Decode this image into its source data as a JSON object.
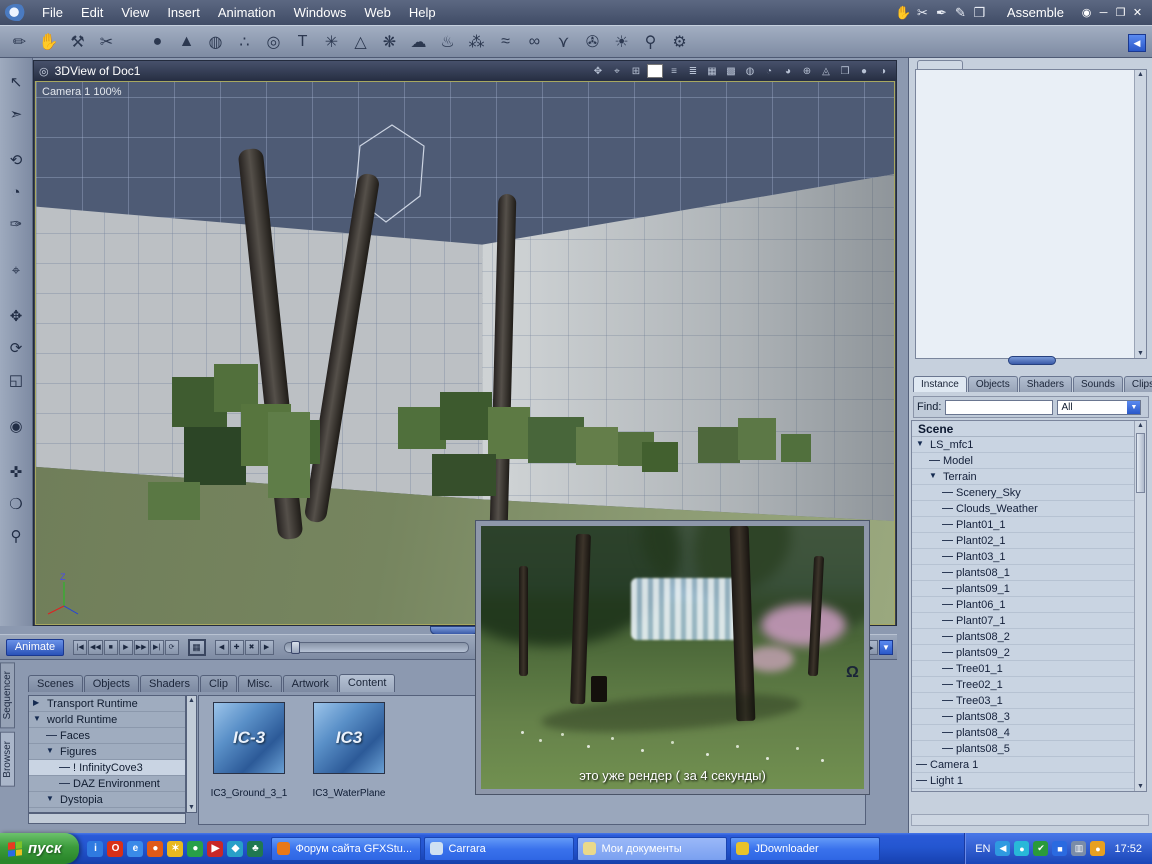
{
  "app": {
    "mode_label": "Assemble"
  },
  "menu": {
    "items": [
      "File",
      "Edit",
      "View",
      "Insert",
      "Animation",
      "Windows",
      "Web",
      "Help"
    ],
    "right_tools": [
      {
        "name": "hand-tool-icon",
        "glyph": "✋"
      },
      {
        "name": "knife-tool-icon",
        "glyph": "✂"
      },
      {
        "name": "pen-tool-icon",
        "glyph": "✒"
      },
      {
        "name": "pencil-tool-icon",
        "glyph": "✎"
      },
      {
        "name": "box-tool-icon",
        "glyph": "❒"
      }
    ],
    "window_buttons": [
      {
        "name": "eye-icon",
        "glyph": "◉"
      },
      {
        "name": "minimize-button",
        "glyph": "─"
      },
      {
        "name": "maximize-button",
        "glyph": "❐"
      },
      {
        "name": "close-button",
        "glyph": "✕"
      }
    ]
  },
  "toolbar": {
    "left_tools": [
      {
        "name": "brush-tool-icon",
        "glyph": "✏"
      },
      {
        "name": "hand-tool-icon",
        "glyph": "✋"
      },
      {
        "name": "wrench-tool-icon",
        "glyph": "⚒"
      },
      {
        "name": "cut-tool-icon",
        "glyph": "✂"
      }
    ],
    "insert_icons": [
      {
        "name": "insert-sphere-icon",
        "glyph": "●"
      },
      {
        "name": "insert-cone-icon",
        "glyph": "▲"
      },
      {
        "name": "insert-geosphere-icon",
        "glyph": "◍"
      },
      {
        "name": "insert-molecule-icon",
        "glyph": "∴"
      },
      {
        "name": "insert-torus-icon",
        "glyph": "◎"
      },
      {
        "name": "insert-text-icon",
        "glyph": "T"
      },
      {
        "name": "insert-particles-icon",
        "glyph": "✳"
      },
      {
        "name": "insert-terrain-icon",
        "glyph": "△"
      },
      {
        "name": "insert-plant-icon",
        "glyph": "❋"
      },
      {
        "name": "insert-cloud-icon",
        "glyph": "☁"
      },
      {
        "name": "insert-fire-icon",
        "glyph": "♨"
      },
      {
        "name": "insert-fountain-icon",
        "glyph": "⁂"
      },
      {
        "name": "insert-ocean-icon",
        "glyph": "≈"
      },
      {
        "name": "insert-metaball-icon",
        "glyph": "∞"
      },
      {
        "name": "insert-bone-icon",
        "glyph": "⋎"
      },
      {
        "name": "insert-camera-icon",
        "glyph": "✇"
      },
      {
        "name": "insert-light-icon",
        "glyph": "☀"
      },
      {
        "name": "insert-walk-icon",
        "glyph": "⚲"
      },
      {
        "name": "insert-gear-icon",
        "glyph": "⚙"
      }
    ]
  },
  "left_tools": [
    {
      "name": "select-tool-icon",
      "glyph": "↖"
    },
    {
      "name": "lasso-tool-icon",
      "glyph": "➣"
    },
    {
      "name": "rotate-view-tool-icon",
      "glyph": "⟲",
      "gap": true
    },
    {
      "name": "sphere-view-tool-icon",
      "glyph": "◔"
    },
    {
      "name": "eyedropper-tool-icon",
      "glyph": "✑"
    },
    {
      "name": "magnet-tool-icon",
      "glyph": "⌖",
      "gap": true
    },
    {
      "name": "move-tool-icon",
      "glyph": "✥",
      "gap": true
    },
    {
      "name": "rotate-tool-icon",
      "glyph": "⟳"
    },
    {
      "name": "scale-tool-icon",
      "glyph": "◱"
    },
    {
      "name": "paint-tool-icon",
      "glyph": "◉",
      "gap": true
    },
    {
      "name": "camera-pan-tool-icon",
      "glyph": "✜",
      "gap": true
    },
    {
      "name": "dolly-tool-icon",
      "glyph": "❍"
    },
    {
      "name": "zoom-tool-icon",
      "glyph": "⚲"
    }
  ],
  "viewport": {
    "title": "3DView of Doc1",
    "icon_glyph": "◎",
    "camera_label": "Camera 1 100%",
    "header_icons": [
      {
        "name": "position-icon",
        "glyph": "✥"
      },
      {
        "name": "aim-icon",
        "glyph": "⌖"
      },
      {
        "name": "grid-icon",
        "glyph": "⊞"
      },
      {
        "name": "white-mode-icon",
        "glyph": "■",
        "active": true
      },
      {
        "name": "wire-mode-icon",
        "glyph": "≡"
      },
      {
        "name": "lines-mode-icon",
        "glyph": "≣"
      },
      {
        "name": "box-mode-icon",
        "glyph": "▦"
      },
      {
        "name": "textured-mode-icon",
        "glyph": "▩"
      },
      {
        "name": "globe-wire-icon",
        "glyph": "◍"
      },
      {
        "name": "globe-flat-icon",
        "glyph": "◔"
      },
      {
        "name": "globe-shaded-icon",
        "glyph": "◕"
      },
      {
        "name": "axis-cross-icon",
        "glyph": "⊕"
      },
      {
        "name": "triangle-icon",
        "glyph": "◬"
      },
      {
        "name": "cube-icon",
        "glyph": "❒"
      },
      {
        "name": "sphere-light-icon",
        "glyph": "●"
      },
      {
        "name": "sphere-dark-icon",
        "glyph": "◑"
      }
    ]
  },
  "transport": {
    "animate_label": "Animate",
    "film_glyph": "▦",
    "buttons": [
      {
        "name": "go-start-button",
        "glyph": "|◀"
      },
      {
        "name": "prev-frame-button",
        "glyph": "◀◀"
      },
      {
        "name": "stop-button",
        "glyph": "■"
      },
      {
        "name": "play-button",
        "glyph": "▶"
      },
      {
        "name": "next-frame-button",
        "glyph": "▶▶"
      },
      {
        "name": "go-end-button",
        "glyph": "▶|"
      },
      {
        "name": "loop-button",
        "glyph": "⟳"
      }
    ],
    "key_buttons": [
      {
        "name": "prev-key-button",
        "glyph": "◀"
      },
      {
        "name": "add-key-button",
        "glyph": "✚"
      },
      {
        "name": "delete-key-button",
        "glyph": "✖"
      },
      {
        "name": "next-key-button",
        "glyph": "▶"
      }
    ],
    "right_buttons": [
      {
        "name": "scroll-left-button",
        "glyph": "◀"
      },
      {
        "name": "scroll-right-button",
        "glyph": "▶"
      },
      {
        "name": "scroll-down-button",
        "glyph": "▼",
        "blue": true
      }
    ]
  },
  "render": {
    "caption": "это уже рендер ( за 4 секунды)"
  },
  "side_tab_items": [
    {
      "label": "Sequencer",
      "name": "tab-sequencer"
    },
    {
      "label": "Browser",
      "name": "tab-browser",
      "active": true
    }
  ],
  "browser": {
    "tabs": [
      {
        "label": "Scenes"
      },
      {
        "label": "Objects"
      },
      {
        "label": "Shaders"
      },
      {
        "label": "Clip"
      },
      {
        "label": "Misc."
      },
      {
        "label": "Artwork"
      },
      {
        "label": "Content",
        "active": true
      }
    ],
    "tree": [
      {
        "label": "Transport Runtime",
        "level": 0,
        "arrow": "right"
      },
      {
        "label": "world Runtime",
        "level": 0,
        "arrow": "down"
      },
      {
        "label": "Faces",
        "level": 1
      },
      {
        "label": "Figures",
        "level": 1,
        "arrow": "down"
      },
      {
        "label": "! InfinityCove3",
        "level": 2,
        "selected": true
      },
      {
        "label": "DAZ Environment",
        "level": 2
      },
      {
        "label": "Dystopia",
        "level": 1,
        "arrow": "down"
      }
    ],
    "items": [
      {
        "label": "IC3_Ground_3_1",
        "art": "IC-3"
      },
      {
        "label": "IC3_WaterPlane",
        "art": "IC3"
      }
    ],
    "audio_glyph": "Ω"
  },
  "right_panel": {
    "collapse_glyph": "◀",
    "tabs": [
      {
        "label": "Instance",
        "active": true
      },
      {
        "label": "Objects"
      },
      {
        "label": "Shaders"
      },
      {
        "label": "Sounds"
      },
      {
        "label": "Clips"
      }
    ],
    "find_label": "Find:",
    "find_value": "",
    "filter_value": "All",
    "scene_label": "Scene",
    "tree": [
      {
        "label": "LS_mfc1",
        "level": 0,
        "arrow": "down"
      },
      {
        "label": "Model",
        "level": 1
      },
      {
        "label": "Terrain",
        "level": 1,
        "arrow": "down"
      },
      {
        "label": "Scenery_Sky",
        "level": 2
      },
      {
        "label": "Clouds_Weather",
        "level": 2
      },
      {
        "label": "Plant01_1",
        "level": 2
      },
      {
        "label": "Plant02_1",
        "level": 2
      },
      {
        "label": "Plant03_1",
        "level": 2
      },
      {
        "label": "plants08_1",
        "level": 2
      },
      {
        "label": "plants09_1",
        "level": 2
      },
      {
        "label": "Plant06_1",
        "level": 2
      },
      {
        "label": "Plant07_1",
        "level": 2
      },
      {
        "label": "plants08_2",
        "level": 2
      },
      {
        "label": "plants09_2",
        "level": 2
      },
      {
        "label": "Tree01_1",
        "level": 2
      },
      {
        "label": "Tree02_1",
        "level": 2
      },
      {
        "label": "Tree03_1",
        "level": 2
      },
      {
        "label": "plants08_3",
        "level": 2
      },
      {
        "label": "plants08_4",
        "level": 2
      },
      {
        "label": "plants08_5",
        "level": 2
      },
      {
        "label": "Camera 1",
        "level": 0
      },
      {
        "label": "Light 1",
        "level": 0
      }
    ]
  },
  "taskbar": {
    "start_label": "пуск",
    "quick_launch": [
      {
        "name": "quick-launch-icon-1",
        "glyph": "i",
        "color": "#2f7ae0"
      },
      {
        "name": "quick-launch-icon-2",
        "glyph": "O",
        "color": "#d83018"
      },
      {
        "name": "quick-launch-icon-3",
        "glyph": "e",
        "color": "#3a8ae8"
      },
      {
        "name": "quick-launch-icon-4",
        "glyph": "●",
        "color": "#e05a18"
      },
      {
        "name": "quick-launch-icon-5",
        "glyph": "✶",
        "color": "#e8b820"
      },
      {
        "name": "quick-launch-icon-6",
        "glyph": "●",
        "color": "#28a048"
      },
      {
        "name": "quick-launch-icon-7",
        "glyph": "▶",
        "color": "#c82828"
      },
      {
        "name": "quick-launch-icon-8",
        "glyph": "◆",
        "color": "#28a0c8"
      },
      {
        "name": "quick-launch-icon-9",
        "glyph": "♣",
        "color": "#207850"
      }
    ],
    "tasks": [
      {
        "label": "Форум сайта GFXStu...",
        "color": "#e87818"
      },
      {
        "label": "Carrara",
        "color": "#cfe0f2"
      },
      {
        "label": "Мои документы",
        "color": "#ead98a",
        "active": true
      },
      {
        "label": "JDownloader",
        "color": "#e8c22a"
      }
    ],
    "tray": {
      "lang": "EN",
      "time": "17:52",
      "icons": [
        {
          "name": "tray-collapse-icon",
          "glyph": "◀",
          "color": "#2f9ae0"
        },
        {
          "name": "tray-icon-1",
          "glyph": "●",
          "color": "#28b8d8"
        },
        {
          "name": "tray-shield-icon",
          "glyph": "✔",
          "color": "#2a9a3a"
        },
        {
          "name": "tray-icon-2",
          "glyph": "■",
          "color": "#2a6ae0"
        },
        {
          "name": "tray-monitor-icon",
          "glyph": "▥",
          "color": "#7a8ca8"
        },
        {
          "name": "tray-icon-3",
          "glyph": "●",
          "color": "#e8a020"
        }
      ]
    }
  }
}
